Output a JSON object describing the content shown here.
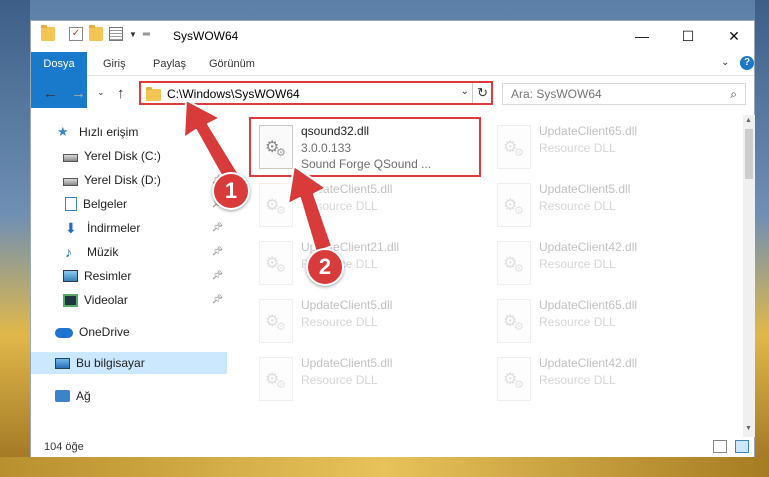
{
  "window": {
    "title": "SysWOW64",
    "minimize_glyph": "—",
    "maximize_glyph": "☐",
    "close_glyph": "✕"
  },
  "ribbon": {
    "tabs": [
      "Dosya",
      "Giriş",
      "Paylaş",
      "Görünüm"
    ],
    "help_glyph": "?"
  },
  "address": {
    "path": "C:\\Windows\\SysWOW64"
  },
  "search": {
    "placeholder": "Ara: SysWOW64"
  },
  "sidebar": {
    "items": [
      {
        "label": "Hızlı erişim",
        "icon": "star-icon"
      },
      {
        "label": "Yerel Disk (C:)",
        "icon": "drive-icon",
        "pinned": true
      },
      {
        "label": "Yerel Disk (D:)",
        "icon": "drive-icon",
        "pinned": true
      },
      {
        "label": "Belgeler",
        "icon": "documents-icon",
        "pinned": true
      },
      {
        "label": "İndirmeler",
        "icon": "downloads-icon",
        "pinned": true
      },
      {
        "label": "Müzik",
        "icon": "music-icon",
        "pinned": true
      },
      {
        "label": "Resimler",
        "icon": "pictures-icon",
        "pinned": true
      },
      {
        "label": "Videolar",
        "icon": "videos-icon",
        "pinned": true
      },
      {
        "label": "OneDrive",
        "icon": "onedrive-icon"
      },
      {
        "label": "Bu bilgisayar",
        "icon": "this-pc-icon",
        "selected": true
      },
      {
        "label": "Ağ",
        "icon": "network-icon"
      }
    ]
  },
  "files": [
    {
      "name": "qsound32.dll",
      "line2": "3.0.0.133",
      "line3": "Sound Forge QSound ...",
      "highlighted": true
    },
    {
      "name": "UpdateClient65.dll",
      "line2": "Resource DLL"
    },
    {
      "name": "UpdateClient5.dll",
      "line2": "Resource DLL"
    },
    {
      "name": "UpdateClient5.dll",
      "line2": "Resource DLL"
    },
    {
      "name": "UpdateClient21.dll",
      "line2": "Resource DLL"
    },
    {
      "name": "UpdateClient42.dll",
      "line2": "Resource DLL"
    },
    {
      "name": "UpdateClient5.dll",
      "line2": "Resource DLL"
    },
    {
      "name": "UpdateClient65.dll",
      "line2": "Resource DLL"
    },
    {
      "name": "UpdateClient5.dll",
      "line2": "Resource DLL"
    },
    {
      "name": "UpdateClient42.dll",
      "line2": "Resource DLL"
    }
  ],
  "status": {
    "item_count": "104 öğe"
  },
  "annotations": {
    "step1": "1",
    "step2": "2",
    "color": "#d93a3a"
  }
}
